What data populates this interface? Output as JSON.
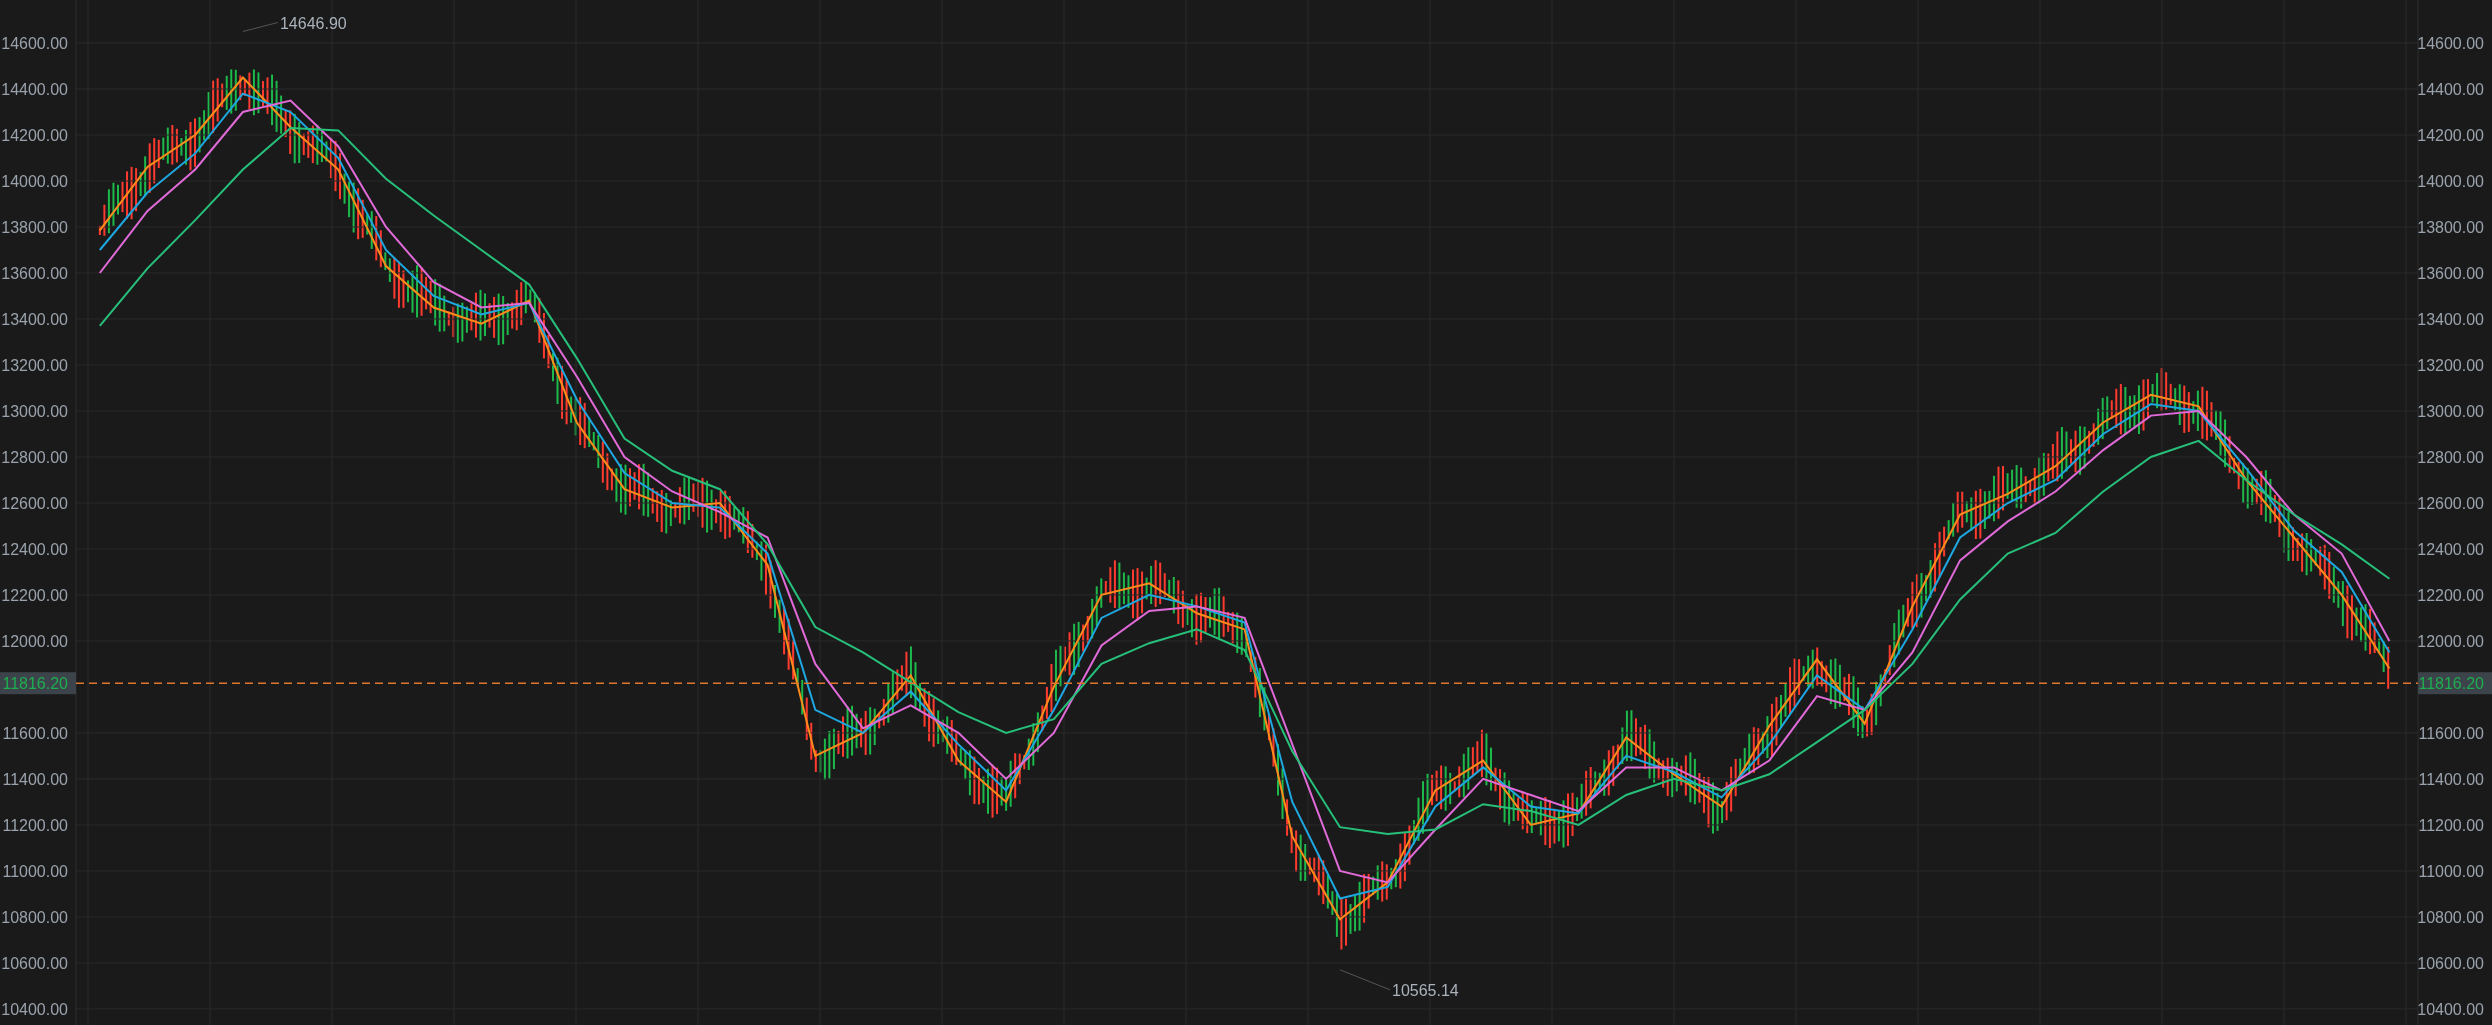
{
  "chart": {
    "chart_data": {
      "type": "line",
      "grid": true,
      "ylim": [
        10330,
        14787
      ],
      "categories": [
        null,
        null,
        null,
        null,
        null,
        null,
        null,
        null,
        null,
        null,
        null,
        null,
        null,
        null,
        null,
        null,
        null,
        null,
        null,
        null,
        null,
        null,
        null,
        null,
        null,
        null,
        null,
        null,
        null,
        null,
        null,
        null,
        null,
        null,
        null,
        null,
        null,
        null,
        null,
        null,
        null,
        null,
        null,
        null,
        null,
        null,
        null,
        null,
        null
      ],
      "yticks": [
        {
          "value": 10400,
          "label": "10400.00"
        },
        {
          "value": 10600,
          "label": "10600.00"
        },
        {
          "value": 10800,
          "label": "10800.00"
        },
        {
          "value": 11000,
          "label": "11000.00"
        },
        {
          "value": 11200,
          "label": "11200.00"
        },
        {
          "value": 11400,
          "label": "11400.00"
        },
        {
          "value": 11600,
          "label": "11600.00"
        },
        {
          "value": 12000,
          "label": "12000.00"
        },
        {
          "value": 12200,
          "label": "12200.00"
        },
        {
          "value": 12400,
          "label": "12400.00"
        },
        {
          "value": 12600,
          "label": "12600.00"
        },
        {
          "value": 12800,
          "label": "12800.00"
        },
        {
          "value": 13000,
          "label": "13000.00"
        },
        {
          "value": 13200,
          "label": "13200.00"
        },
        {
          "value": 13400,
          "label": "13400.00"
        },
        {
          "value": 13600,
          "label": "13600.00"
        },
        {
          "value": 13800,
          "label": "13800.00"
        },
        {
          "value": 14000,
          "label": "14000.00"
        },
        {
          "value": 14200,
          "label": "14200.00"
        },
        {
          "value": 14400,
          "label": "14400.00"
        },
        {
          "value": 14600,
          "label": "14600.00"
        }
      ],
      "series": [
        {
          "color": "#ff8c1a",
          "values": [
            13785,
            14061,
            14200,
            14450,
            14234,
            14050,
            13630,
            13450,
            13380,
            13480,
            12950,
            12660,
            12580,
            12600,
            12330,
            11500,
            11600,
            11850,
            11480,
            11300,
            11800,
            12200,
            12250,
            12120,
            12050,
            11150,
            10790,
            10950,
            11350,
            11480,
            11200,
            11250,
            11580,
            11420,
            11280,
            11630,
            11920,
            11640,
            12150,
            12550,
            12640,
            12760,
            12950,
            13070,
            13020,
            12700,
            12450,
            12200,
            11880
          ]
        },
        {
          "color": "#1ea7e0",
          "values": [
            13700,
            13950,
            14120,
            14380,
            14300,
            14100,
            13700,
            13500,
            13420,
            13470,
            13050,
            12730,
            12600,
            12580,
            12380,
            11700,
            11600,
            11780,
            11550,
            11350,
            11700,
            12100,
            12200,
            12150,
            12080,
            11300,
            10880,
            10930,
            11280,
            11450,
            11280,
            11250,
            11500,
            11430,
            11320,
            11550,
            11850,
            11700,
            12050,
            12450,
            12600,
            12700,
            12900,
            13030,
            13000,
            12750,
            12480,
            12300,
            11950
          ]
        },
        {
          "color": "#e06ad8",
          "values": [
            13600,
            13870,
            14050,
            14300,
            14350,
            14150,
            13800,
            13560,
            13450,
            13470,
            13150,
            12800,
            12650,
            12560,
            12450,
            11900,
            11620,
            11720,
            11600,
            11400,
            11600,
            11980,
            12130,
            12150,
            12100,
            11550,
            11000,
            10950,
            11180,
            11400,
            11330,
            11260,
            11450,
            11450,
            11350,
            11480,
            11760,
            11700,
            11950,
            12350,
            12520,
            12650,
            12830,
            12980,
            13000,
            12800,
            12550,
            12380,
            12000
          ]
        },
        {
          "color": "#27c07a",
          "values": [
            13370,
            13620,
            13830,
            14050,
            14230,
            14220,
            14010,
            13850,
            13700,
            13550,
            13230,
            12880,
            12740,
            12660,
            12420,
            12060,
            11950,
            11820,
            11690,
            11600,
            11660,
            11900,
            11990,
            12050,
            11960,
            11520,
            11190,
            11160,
            11180,
            11290,
            11260,
            11200,
            11330,
            11400,
            11350,
            11420,
            11560,
            11700,
            11900,
            12180,
            12380,
            12470,
            12650,
            12800,
            12870,
            12700,
            12550,
            12420,
            12270
          ]
        }
      ],
      "annotations": [
        "14646.90",
        "10565.14"
      ],
      "ref_lines": [
        {
          "axis": "y",
          "value": 11816.2,
          "label": "11816.20"
        }
      ]
    },
    "right_axis": {
      "labels": [
        "14600.00",
        "14400.00",
        "14200.00",
        "14000.00",
        "13800.00",
        "13600.00",
        "13400.00",
        "13200.00",
        "13000.00",
        "12800.00",
        "12600.00",
        "12400.00",
        "12200.00",
        "12000.00",
        "11600.00",
        "11400.00",
        "11200.00",
        "11000.00",
        "10800.00",
        "10600.00",
        "10400.00"
      ],
      "price_tag": "11816.20"
    }
  }
}
